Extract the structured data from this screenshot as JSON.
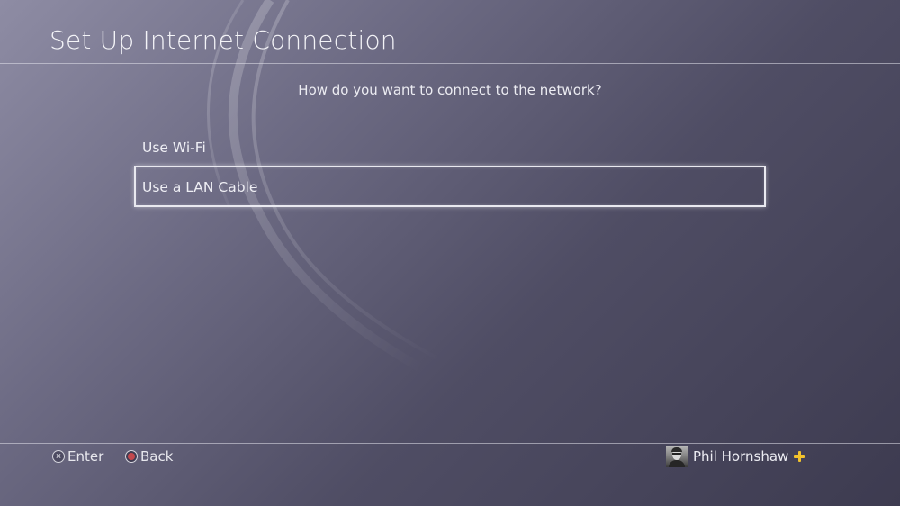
{
  "header": {
    "title": "Set Up Internet Connection"
  },
  "main": {
    "prompt": "How do you want to connect to the network?",
    "options": [
      {
        "label": "Use Wi-Fi",
        "selected": false
      },
      {
        "label": "Use a LAN Cable",
        "selected": true
      }
    ]
  },
  "footer": {
    "enter": {
      "icon": "cross-button-icon",
      "label": "Enter"
    },
    "back": {
      "icon": "circle-button-icon",
      "label": "Back"
    },
    "user": {
      "name": "Phil Hornshaw",
      "badge": "playstation-plus-icon"
    }
  },
  "colors": {
    "background": "#5a5870",
    "highlight_border": "#e9e9f0",
    "plus_badge": "#f2c22c",
    "circle_button": "#c2484d"
  }
}
